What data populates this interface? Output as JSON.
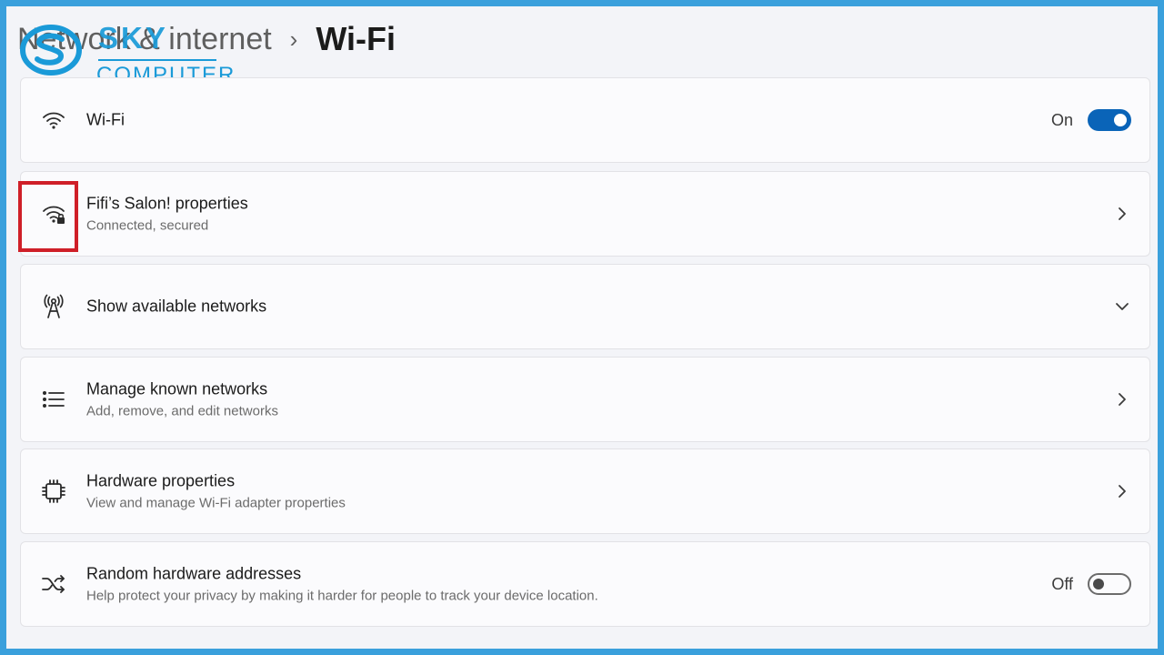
{
  "breadcrumb": {
    "parent": "Network & internet",
    "separator": "›",
    "current": "Wi-Fi"
  },
  "watermark": {
    "brand_top": "SKY",
    "brand_bottom": "COMPUTER",
    "color": "#1a9ad8"
  },
  "rows": {
    "wifi": {
      "icon": "wifi-icon",
      "title": "Wi-Fi",
      "toggle_label": "On",
      "toggle_on": true
    },
    "properties": {
      "icon": "wifi-lock-icon",
      "title": "Fifi’s Salon! properties",
      "subtitle": "Connected, secured",
      "action_icon": "chevron-right-icon"
    },
    "available": {
      "icon": "antenna-icon",
      "title": "Show available networks",
      "action_icon": "chevron-down-icon"
    },
    "known": {
      "icon": "list-icon",
      "title": "Manage known networks",
      "subtitle": "Add, remove, and edit networks",
      "action_icon": "chevron-right-icon"
    },
    "hardware": {
      "icon": "chip-icon",
      "title": "Hardware properties",
      "subtitle": "View and manage Wi-Fi adapter properties",
      "action_icon": "chevron-right-icon"
    },
    "random": {
      "icon": "shuffle-icon",
      "title": "Random hardware addresses",
      "subtitle": "Help protect your privacy by making it harder for people to track your device location.",
      "toggle_label": "Off",
      "toggle_on": false
    }
  },
  "colors": {
    "accent": "#0a64b8",
    "highlight": "#cf1f28",
    "frame": "#3aa0dc"
  }
}
